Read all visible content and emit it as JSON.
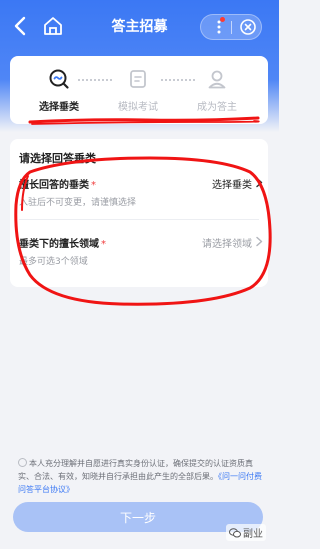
{
  "header": {
    "title": "答主招募",
    "back_icon": "chevron-left-icon",
    "home_icon": "home-icon",
    "more_icon": "more-vertical-icon",
    "close_icon": "close-circle-icon",
    "notification_dot_color": "#ff3b30",
    "accent_color": "#3b78f4"
  },
  "steps": [
    {
      "label": "选择垂类",
      "icon": "search-chat-icon",
      "active": true
    },
    {
      "label": "模拟考试",
      "icon": "document-icon",
      "active": false
    },
    {
      "label": "成为答主",
      "icon": "user-icon",
      "active": false
    }
  ],
  "form": {
    "title": "请选择回答垂类",
    "rows": [
      {
        "label": "擅长回答的垂类",
        "required_mark": "*",
        "value": "选择垂类",
        "hint": "入驻后不可变更，请谨慎选择"
      },
      {
        "label": "垂类下的擅长领域",
        "required_mark": "*",
        "value": "请选择领域",
        "hint": "最多可选3个领域"
      }
    ]
  },
  "agreement": {
    "text": "本人充分理解并自愿进行真实身份认证，确保提交的认证资质真实、合法、有效，知晓并自行承担由此产生的全部后果。",
    "link": "《问一问付费问答平台协议》"
  },
  "buttons": {
    "next": "下一步"
  },
  "watermark": {
    "text": "副业",
    "icon": "wechat-icon"
  },
  "colors": {
    "annotation_red": "#f01414",
    "required_red": "#f03d3d",
    "button_disabled": "#a9c2f6"
  }
}
